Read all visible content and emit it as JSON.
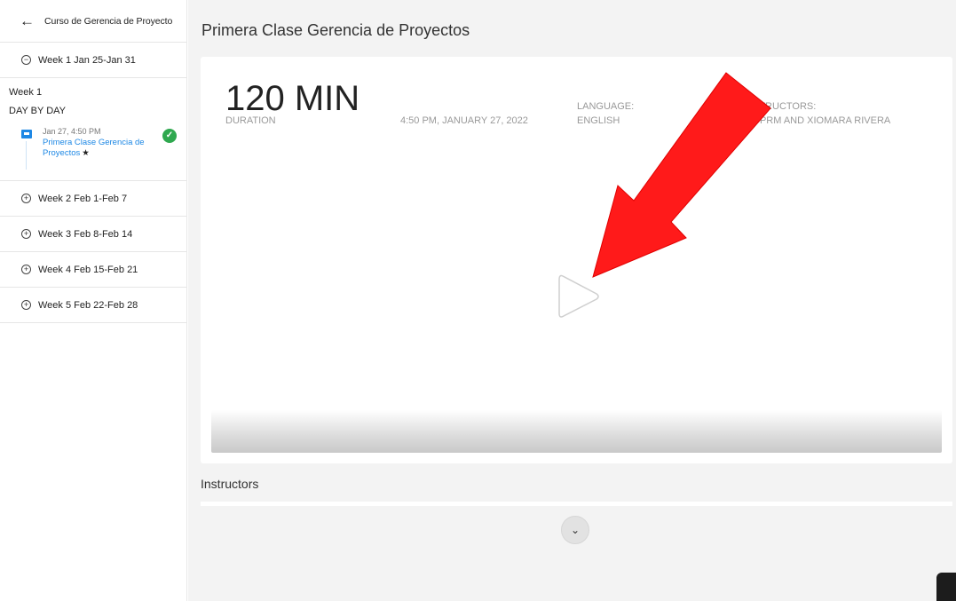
{
  "sidebar": {
    "course_title": "Curso de Gerencia de Proyecto",
    "back_glyph": "←",
    "week1_collapsed_label": "Week 1 Jan 25-Jan 31",
    "week1": {
      "label": "Week 1",
      "subheading": "DAY BY DAY",
      "lesson": {
        "date": "Jan 27, 4:50 PM",
        "title": "Primera Clase Gerencia de Proyectos",
        "star": "★",
        "status_icon": "check-circle-icon",
        "status_color": "#2fa84f"
      }
    },
    "weeks": [
      {
        "label": "Week 2 Feb 1-Feb 7"
      },
      {
        "label": "Week 3 Feb 8-Feb 14"
      },
      {
        "label": "Week 4 Feb 15-Feb 21"
      },
      {
        "label": "Week 5 Feb 22-Feb 28"
      }
    ],
    "collapse_glyph": "−",
    "expand_glyph": "+"
  },
  "main": {
    "page_title": "Primera Clase Gerencia de Proyectos",
    "session": {
      "duration_value": "120 MIN",
      "duration_label": "DURATION",
      "datetime": "4:50 PM, JANUARY 27, 2022",
      "language_label": "LANGUAGE:",
      "language_value": "ENGLISH",
      "instructors_label": "STRUCTORS:",
      "instructors_value": "UPRM  AND XIOMARA RIVERA"
    },
    "instructors_heading": "Instructors",
    "expand_glyph": "⌄"
  },
  "colors": {
    "accent": "#1e88e5",
    "annotation_arrow": "#ff0000",
    "success": "#2fa84f"
  }
}
